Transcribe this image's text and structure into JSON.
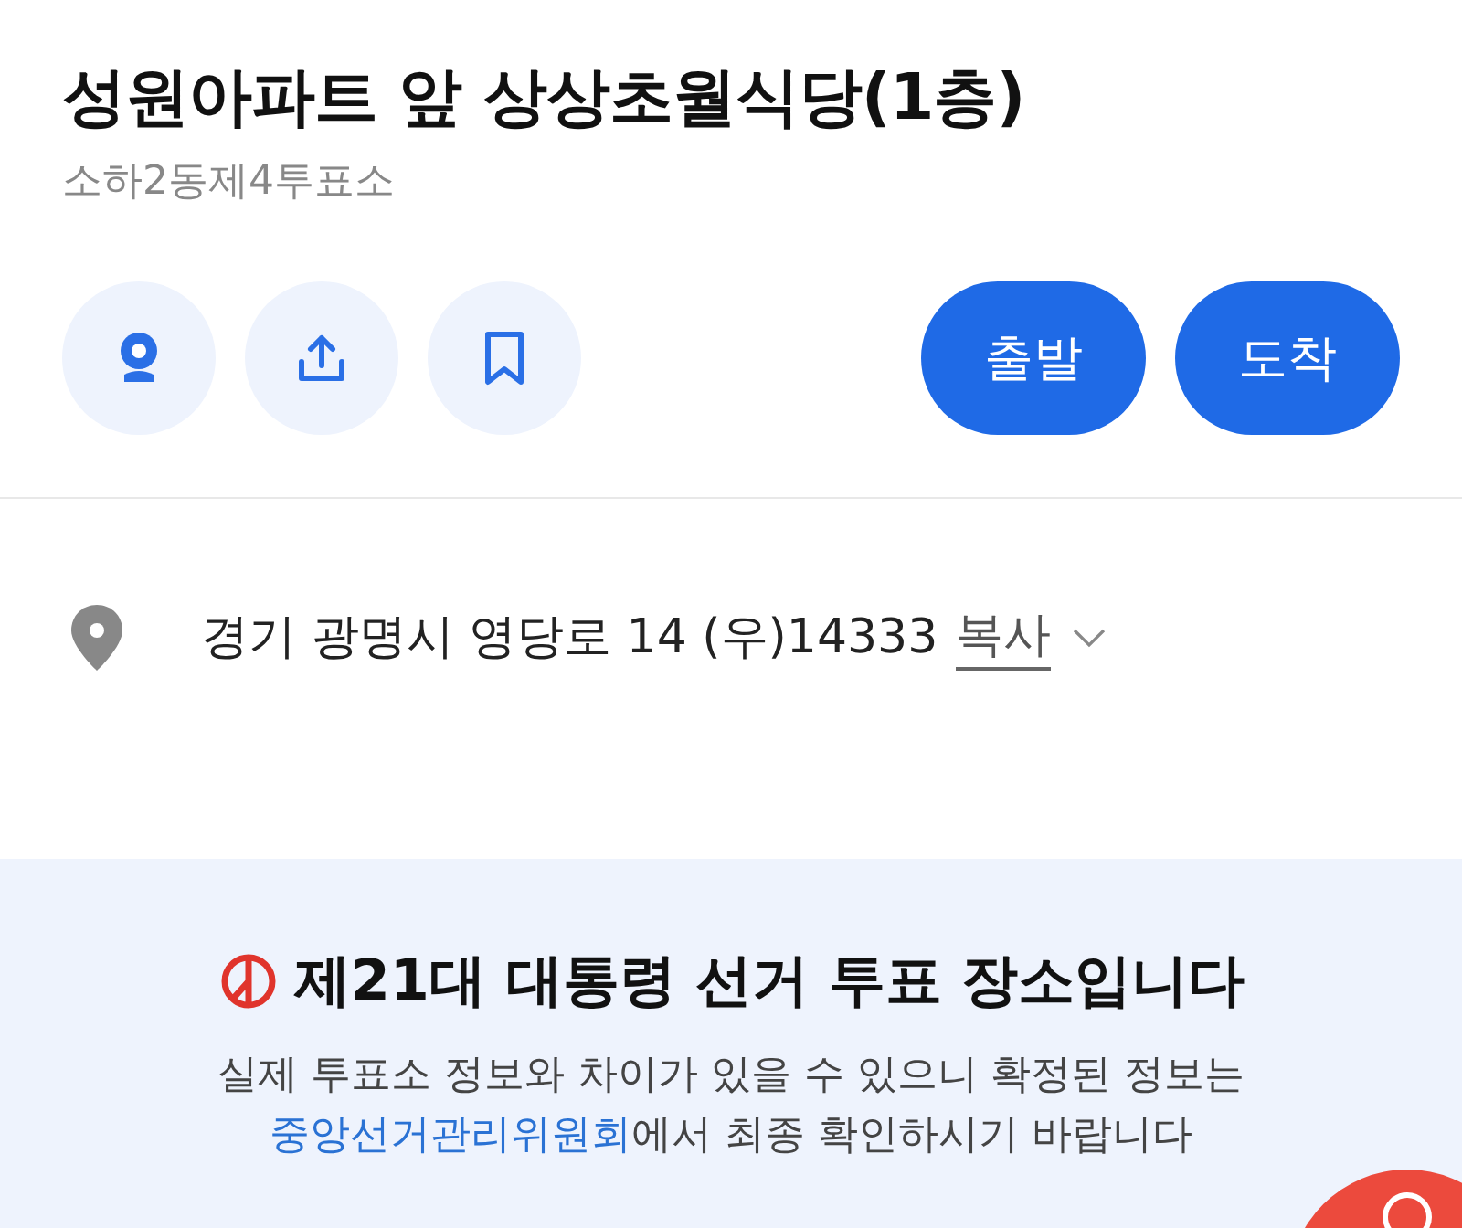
{
  "place": {
    "title": "성원아파트 앞 상상초월식당(1층)",
    "subtitle": "소하2동제4투표소"
  },
  "actions": [
    {
      "kind": "roadview"
    },
    {
      "kind": "share"
    },
    {
      "kind": "bookmark"
    }
  ],
  "route_buttons": [
    "출발",
    "도착"
  ],
  "address": {
    "text": "경기 광명시 영당로 14 (우)14333",
    "copy": "복사",
    "expanded": false
  },
  "notice": {
    "heading": "제21대 대통령 선거 투표 장소입니다",
    "line1": "실제 투표소 정보와 차이가 있을 수 있으니 확정된 정보는",
    "link": "중앙선거관리위원회",
    "line2_rest": "에서 최종 확인하시기 바랍니다"
  }
}
